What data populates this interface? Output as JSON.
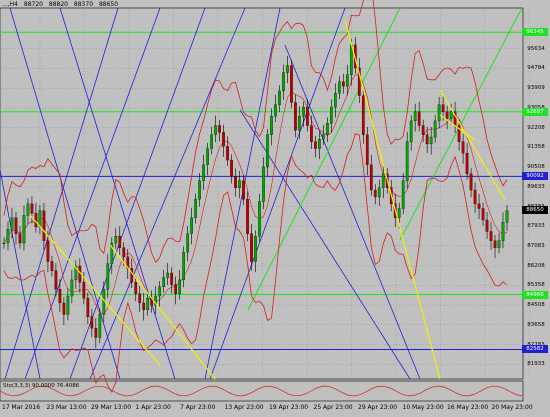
{
  "header": {
    "symbol_period": "...,H4",
    "open": "88720",
    "high": "88820",
    "low": "88370",
    "close": "88650"
  },
  "subwindow": {
    "label": "Sto(3,3,3) 90.0000 76.4086"
  },
  "colors": {
    "background": "#c0c0c0",
    "grid": "#808080",
    "bull": "#00aa00",
    "bear": "#c00000",
    "bands": "#d02020",
    "channel_blue": "#2020d0",
    "fan_green": "#20e020",
    "trend_yellow": "#f0f000"
  },
  "chart_data": {
    "type": "candlestick",
    "title": "",
    "ylim": [
      81300,
      97400
    ],
    "y_ticks": [
      "95634",
      "94784",
      "93909",
      "93058",
      "92208",
      "91358",
      "90508",
      "89633",
      "88783",
      "87933",
      "87083",
      "86208",
      "85358",
      "84508",
      "83658",
      "82783",
      "81933"
    ],
    "x_ticks": [
      "17 Mar 2016",
      "23 Mar 13:00",
      "29 Mar 13:00",
      "1 Apr 23:00",
      "7 Apr 23:00",
      "13 Apr 23:00",
      "19 Apr 23:00",
      "25 Apr 23:00",
      "29 Apr 23:00",
      "10 May 23:00",
      "16 May 23:00",
      "20 May 23:00"
    ],
    "horizontal_levels": [
      {
        "label": "96345",
        "value": 96345,
        "color": "#20e020"
      },
      {
        "label": "92897",
        "value": 92897,
        "color": "#20e020"
      },
      {
        "label": "90092",
        "value": 90092,
        "color": "#2020d0"
      },
      {
        "label": "84966",
        "value": 84966,
        "color": "#20e020"
      },
      {
        "label": "82582",
        "value": 82582,
        "color": "#2020d0"
      }
    ],
    "current_price": {
      "label": "88650",
      "value": 88650
    },
    "close_path": [
      [
        0,
        87200
      ],
      [
        4,
        87800
      ],
      [
        8,
        88300
      ],
      [
        12,
        87600
      ],
      [
        16,
        87200
      ],
      [
        20,
        88400
      ],
      [
        24,
        88900
      ],
      [
        28,
        88500
      ],
      [
        32,
        87900
      ],
      [
        36,
        88600
      ],
      [
        40,
        87300
      ],
      [
        44,
        86400
      ],
      [
        48,
        86000
      ],
      [
        52,
        85200
      ],
      [
        56,
        84600
      ],
      [
        60,
        84100
      ],
      [
        64,
        84900
      ],
      [
        68,
        85600
      ],
      [
        72,
        86200
      ],
      [
        76,
        85500
      ],
      [
        80,
        84800
      ],
      [
        84,
        84000
      ],
      [
        88,
        83500
      ],
      [
        92,
        83100
      ],
      [
        96,
        84100
      ],
      [
        100,
        85200
      ],
      [
        104,
        86300
      ],
      [
        108,
        87200
      ],
      [
        112,
        87500
      ],
      [
        116,
        87000
      ],
      [
        120,
        86600
      ],
      [
        124,
        86100
      ],
      [
        128,
        85500
      ],
      [
        132,
        85000
      ],
      [
        136,
        84600
      ],
      [
        140,
        84300
      ],
      [
        144,
        84800
      ],
      [
        148,
        84500
      ],
      [
        152,
        84900
      ],
      [
        156,
        85300
      ],
      [
        160,
        85700
      ],
      [
        164,
        85900
      ],
      [
        168,
        85400
      ],
      [
        172,
        85000
      ],
      [
        176,
        85600
      ],
      [
        180,
        86800
      ],
      [
        184,
        87600
      ],
      [
        188,
        88300
      ],
      [
        192,
        89100
      ],
      [
        196,
        89900
      ],
      [
        200,
        90600
      ],
      [
        204,
        91300
      ],
      [
        208,
        91900
      ],
      [
        212,
        92300
      ],
      [
        216,
        92000
      ],
      [
        220,
        91400
      ],
      [
        224,
        90800
      ],
      [
        228,
        90100
      ],
      [
        232,
        89600
      ],
      [
        236,
        89900
      ],
      [
        240,
        89100
      ],
      [
        244,
        87600
      ],
      [
        248,
        86400
      ],
      [
        252,
        87500
      ],
      [
        256,
        89000
      ],
      [
        260,
        90500
      ],
      [
        264,
        91900
      ],
      [
        268,
        92700
      ],
      [
        272,
        93200
      ],
      [
        276,
        93800
      ],
      [
        280,
        94600
      ],
      [
        284,
        94900
      ],
      [
        288,
        93300
      ],
      [
        292,
        92100
      ],
      [
        296,
        92700
      ],
      [
        300,
        93100
      ],
      [
        304,
        92300
      ],
      [
        308,
        91600
      ],
      [
        312,
        91300
      ],
      [
        316,
        91700
      ],
      [
        320,
        91900
      ],
      [
        324,
        92400
      ],
      [
        328,
        93100
      ],
      [
        332,
        93700
      ],
      [
        336,
        94200
      ],
      [
        340,
        94000
      ],
      [
        344,
        94500
      ],
      [
        348,
        95800
      ],
      [
        352,
        94800
      ],
      [
        356,
        93600
      ],
      [
        360,
        91900
      ],
      [
        364,
        90600
      ],
      [
        368,
        89500
      ],
      [
        372,
        89200
      ],
      [
        376,
        89600
      ],
      [
        380,
        90200
      ],
      [
        384,
        89600
      ],
      [
        388,
        88900
      ],
      [
        392,
        88300
      ],
      [
        396,
        88700
      ],
      [
        400,
        89900
      ],
      [
        404,
        91600
      ],
      [
        408,
        92500
      ],
      [
        412,
        92900
      ],
      [
        416,
        92300
      ],
      [
        420,
        91900
      ],
      [
        424,
        91500
      ],
      [
        428,
        91800
      ],
      [
        432,
        92500
      ],
      [
        436,
        93200
      ],
      [
        440,
        92900
      ],
      [
        444,
        92600
      ],
      [
        448,
        92900
      ],
      [
        452,
        92300
      ],
      [
        456,
        91600
      ],
      [
        460,
        91100
      ],
      [
        464,
        90200
      ],
      [
        468,
        89500
      ],
      [
        472,
        88900
      ],
      [
        476,
        88700
      ],
      [
        480,
        88200
      ],
      [
        484,
        87700
      ],
      [
        488,
        87300
      ],
      [
        492,
        87000
      ],
      [
        496,
        87300
      ],
      [
        500,
        88100
      ],
      [
        504,
        88600
      ]
    ]
  }
}
